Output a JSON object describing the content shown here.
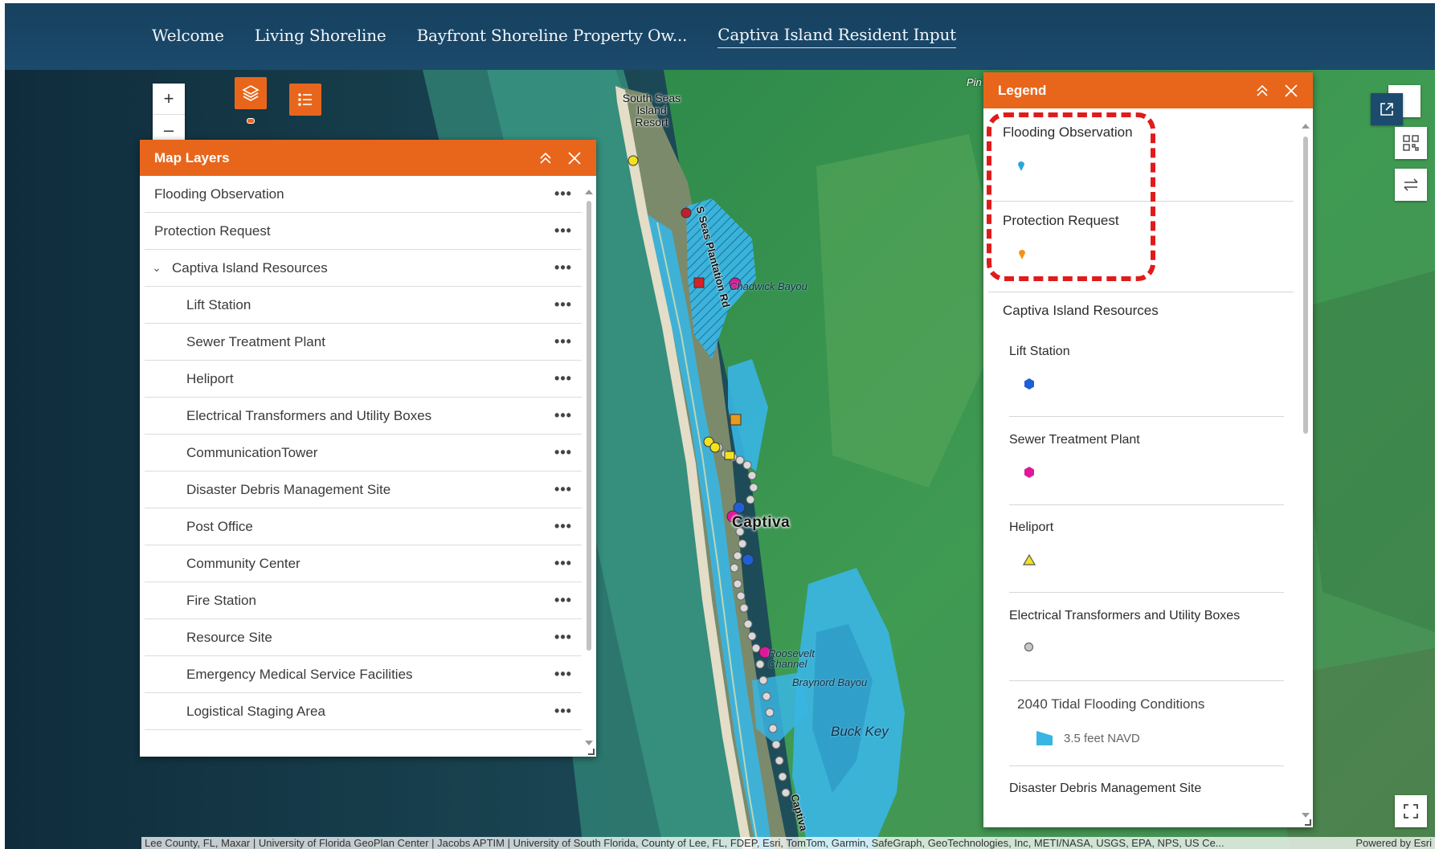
{
  "nav": {
    "tabs": [
      {
        "label": "Welcome"
      },
      {
        "label": "Living Shoreline"
      },
      {
        "label": "Bayfront Shoreline Property Ow..."
      },
      {
        "label": "Captiva Island Resident Input"
      }
    ]
  },
  "map": {
    "labels": {
      "resort": "South Seas Island Resort",
      "road": "S Seas Plantation Rd",
      "chadwick": "Chadwick Bayou",
      "town": "Captiva",
      "roosevelt": "Roosevelt Channel",
      "braynord": "Braynord Bayou",
      "buck_key": "Buck Key",
      "captiva_dr": "Captiva",
      "pine": "Pin"
    },
    "zoom_in": "+",
    "zoom_out": "–"
  },
  "map_layers": {
    "title": "Map Layers",
    "items": [
      {
        "label": "Flooding Observation",
        "level": "top"
      },
      {
        "label": "Protection Request",
        "level": "top"
      },
      {
        "label": "Captiva Island Resources",
        "level": "group"
      },
      {
        "label": "Lift Station",
        "level": "child"
      },
      {
        "label": "Sewer Treatment Plant",
        "level": "child"
      },
      {
        "label": "Heliport",
        "level": "child"
      },
      {
        "label": "Electrical Transformers and Utility Boxes",
        "level": "child"
      },
      {
        "label": "CommunicationTower",
        "level": "child"
      },
      {
        "label": "Disaster Debris Management Site",
        "level": "child"
      },
      {
        "label": "Post Office",
        "level": "child"
      },
      {
        "label": "Community Center",
        "level": "child"
      },
      {
        "label": "Fire Station",
        "level": "child"
      },
      {
        "label": "Resource Site",
        "level": "child"
      },
      {
        "label": "Emergency Medical Service Facilities",
        "level": "child"
      },
      {
        "label": "Logistical Staging Area",
        "level": "child"
      }
    ],
    "more_glyph": "•••"
  },
  "legend": {
    "title": "Legend",
    "flooding_observation": "Flooding Observation",
    "protection_request": "Protection Request",
    "resources_group": "Captiva Island Resources",
    "lift_station": "Lift Station",
    "sewer_treatment_plant": "Sewer Treatment Plant",
    "heliport": "Heliport",
    "electrical": "Electrical Transformers and Utility Boxes",
    "tidal_flooding": "2040 Tidal Flooding Conditions",
    "tidal_value": "3.5 feet NAVD",
    "debris_site": "Disaster Debris Management Site"
  },
  "colors": {
    "accent": "#e8661c",
    "nav_bg": "#17415f",
    "highlight": "#e01b1b",
    "flood_blue": "#39b5e3",
    "lift_station": "#1f5fd6",
    "sewer": "#e0179a",
    "heliport": "#f2e21c"
  },
  "attribution": {
    "text": "Lee County, FL, Maxar | University of Florida GeoPlan Center | Jacobs APTIM | University of South Florida, County of Lee, FL, FDEP, Esri, TomTom, Garmin, SafeGraph, GeoTechnologies, Inc, METI/NASA, USGS, EPA, NPS, US Ce...",
    "powered": "Powered by Esri"
  }
}
